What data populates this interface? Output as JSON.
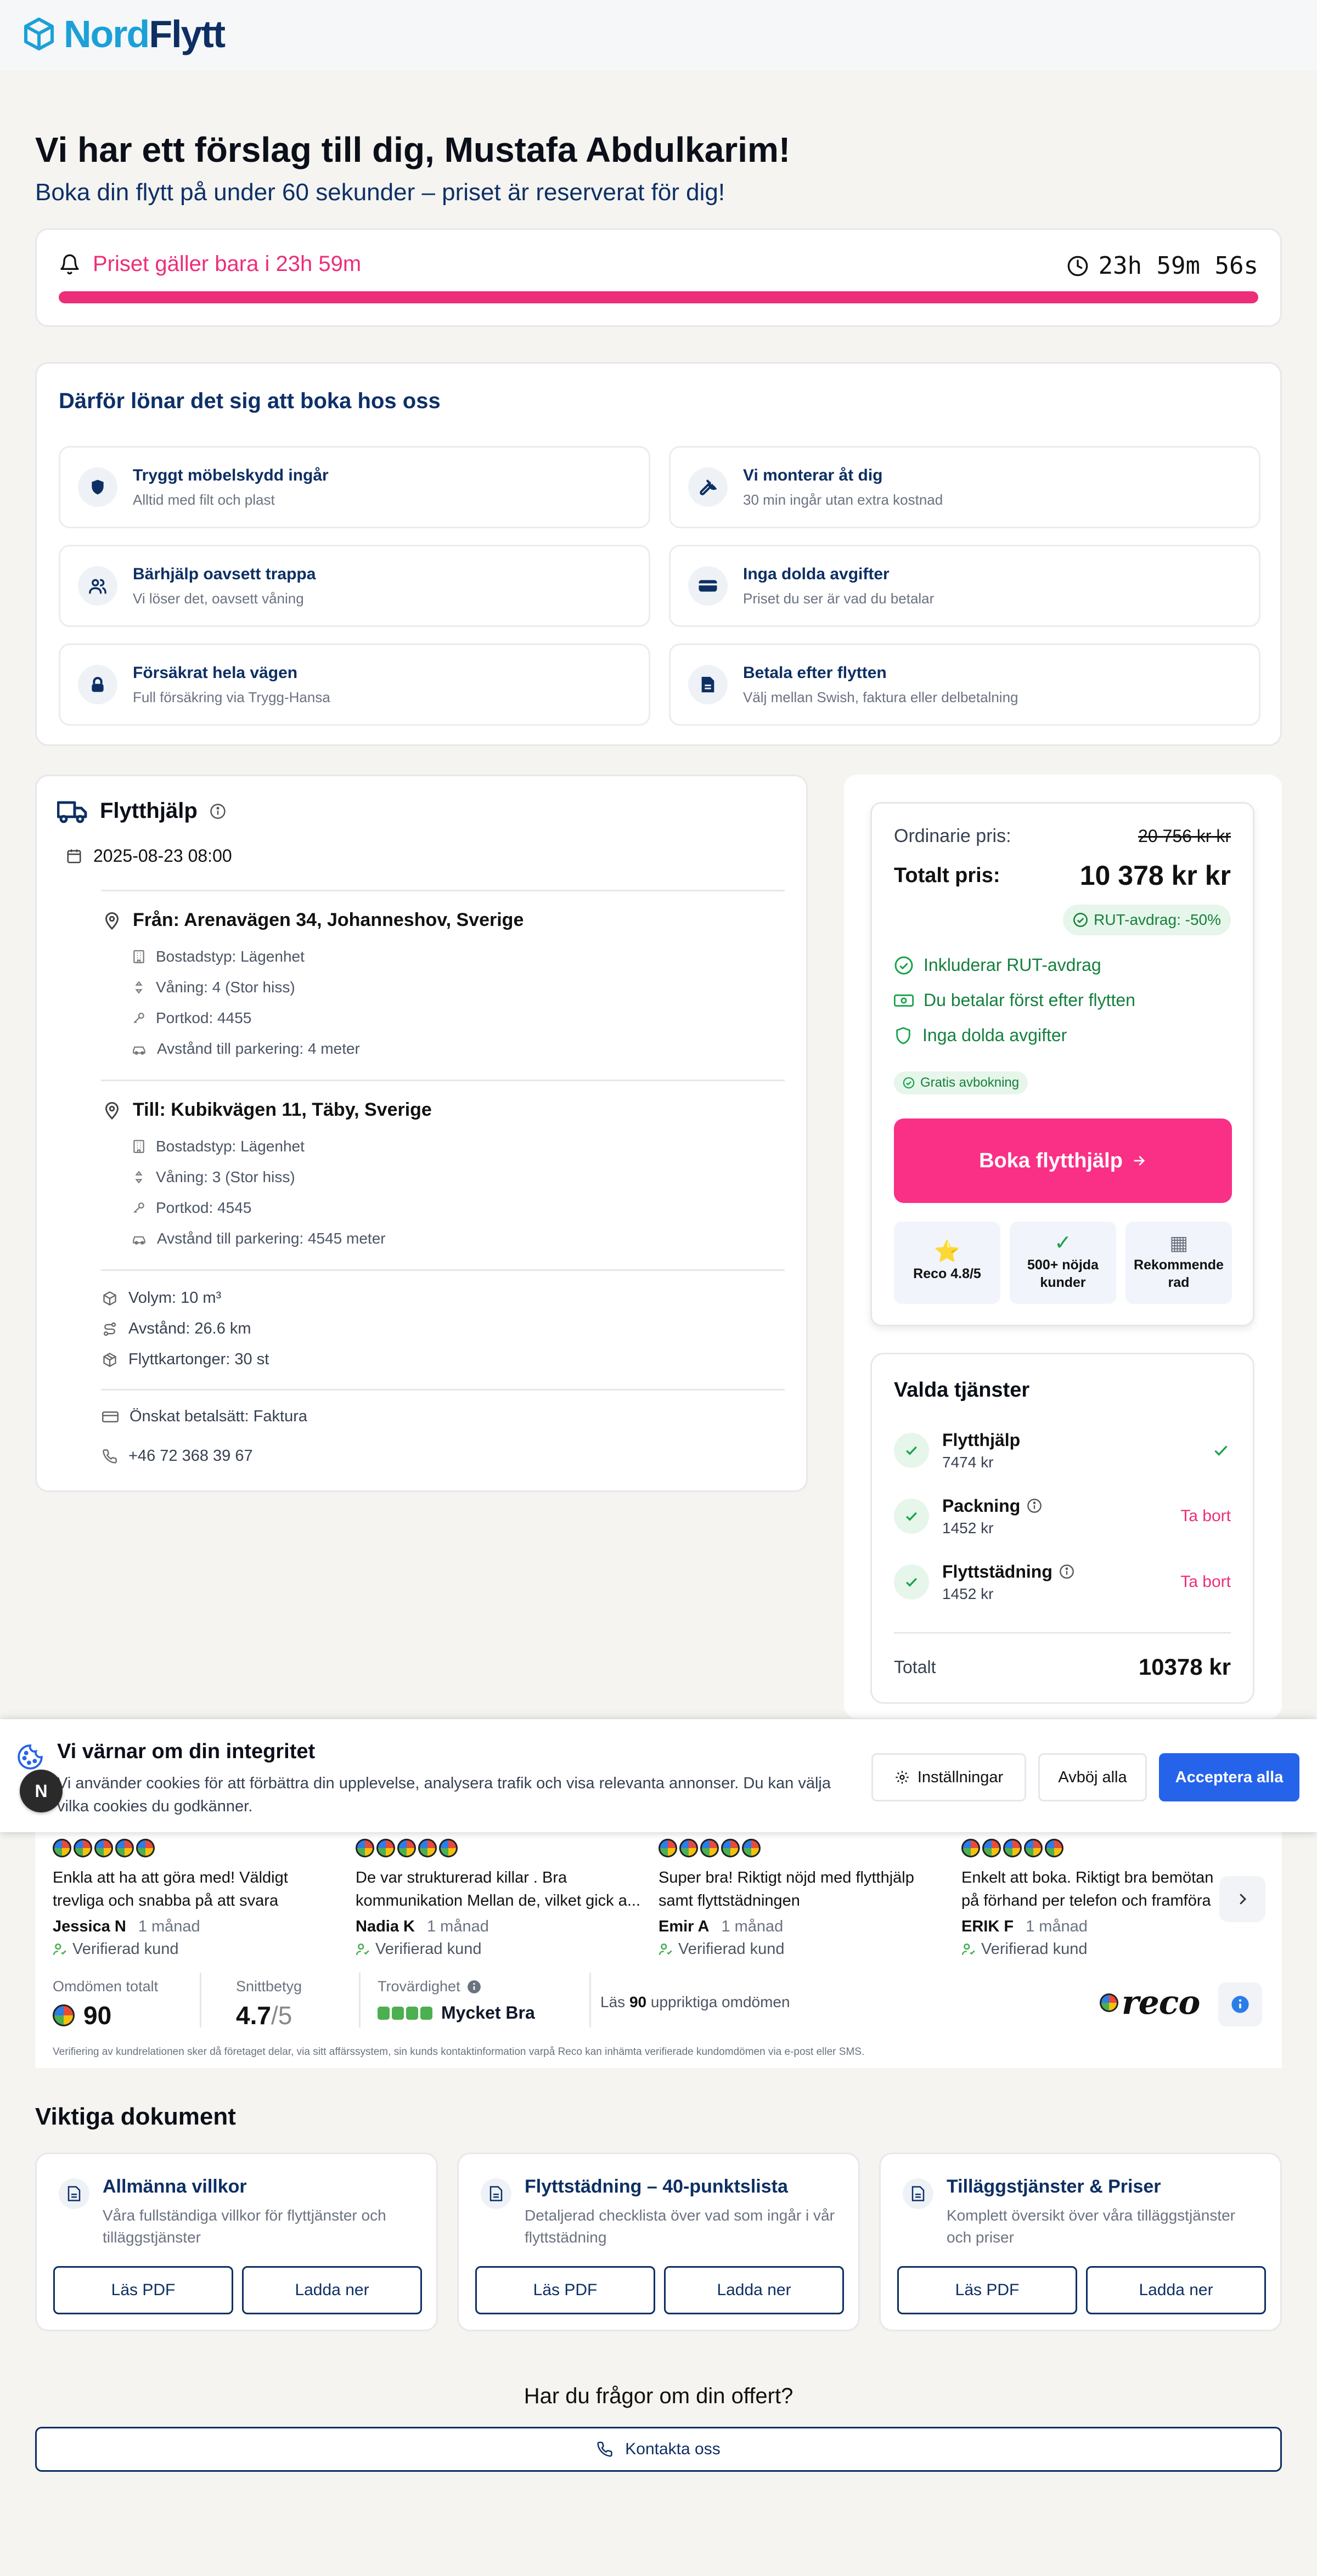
{
  "brand": {
    "nord": "Nord",
    "flytt": "Flytt"
  },
  "greeting": {
    "title": "Vi har ett förslag till dig, Mustafa Abdulkarim!",
    "subtitle": "Boka din flytt på under 60 sekunder – priset är reserverat för dig!"
  },
  "timer": {
    "label": "Priset gäller bara i 23h 59m",
    "countdown": "23h 59m 56s",
    "progress_percent": 100
  },
  "benefits": {
    "title": "Därför lönar det sig att boka hos oss",
    "items": [
      {
        "icon": "shield-icon",
        "title": "Tryggt möbelskydd ingår",
        "sub": "Alltid med filt och plast"
      },
      {
        "icon": "wrench-icon",
        "title": "Vi monterar åt dig",
        "sub": "30 min ingår utan extra kostnad"
      },
      {
        "icon": "people-icon",
        "title": "Bärhjälp oavsett trappa",
        "sub": "Vi löser det, oavsett våning"
      },
      {
        "icon": "card-icon",
        "title": "Inga dolda avgifter",
        "sub": "Priset du ser är vad du betalar"
      },
      {
        "icon": "lock-icon",
        "title": "Försäkrat hela vägen",
        "sub": "Full försäkring via Trygg-Hansa"
      },
      {
        "icon": "document-icon",
        "title": "Betala efter flytten",
        "sub": "Välj mellan Swish, faktura eller delbetalning"
      }
    ]
  },
  "details": {
    "service": "Flytthjälp",
    "date": "2025-08-23 08:00",
    "from": {
      "address": "Från: Arenavägen 34, Johanneshov, Sverige",
      "housing": "Bostadstyp: Lägenhet",
      "floor": "Våning: 4 (Stor hiss)",
      "code": "Portkod: 4455",
      "parking": "Avstånd till parkering: 4 meter"
    },
    "to": {
      "address": "Till: Kubikvägen 11, Täby, Sverige",
      "housing": "Bostadstyp: Lägenhet",
      "floor": "Våning: 3 (Stor hiss)",
      "code": "Portkod: 4545",
      "parking": "Avstånd till parkering: 4545 meter"
    },
    "volume": "Volym: 10 m³",
    "distance": "Avstånd: 26.6 km",
    "boxes": "Flyttkartonger: 30 st",
    "payment": "Önskat betalsätt: Faktura",
    "phone": "+46 72 368 39 67"
  },
  "price": {
    "ordinary_label": "Ordinarie pris:",
    "ordinary_value": "20 756 kr kr",
    "total_label": "Totalt pris:",
    "total_value": "10 378 kr kr",
    "rut": "RUT-avdrag: -50%",
    "check1": "Inkluderar RUT-avdrag",
    "check2": "Du betalar först efter flytten",
    "check3": "Inga dolda avgifter",
    "free_cancel": "Gratis avbokning",
    "book_button": "Boka flytthjälp",
    "badges": [
      {
        "icon": "⭐",
        "label": "Reco 4.8/5"
      },
      {
        "icon": "✓",
        "label": "500+ nöjda kunder"
      },
      {
        "icon": "▦",
        "label": "Rekommenderad"
      }
    ]
  },
  "services": {
    "title": "Valda tjänster",
    "items": [
      {
        "name": "Flytthjälp",
        "price": "7474 kr"
      },
      {
        "name": "Packning",
        "price": "1452 kr",
        "action": "Ta bort"
      },
      {
        "name": "Flyttstädning",
        "price": "1452 kr",
        "action": "Ta bort"
      }
    ],
    "total_label": "Totalt",
    "total_value": "10378 kr"
  },
  "cookie": {
    "title": "Vi värnar om din integritet",
    "text": "Vi använder cookies för att förbättra din upplevelse, analysera trafik och visa relevanta annonser. Du kan välja vilka cookies du godkänner.",
    "settings": "Inställningar",
    "reject": "Avböj alla",
    "accept": "Acceptera alla",
    "avatar": "N"
  },
  "reviews": {
    "items": [
      {
        "text": "Enkla att ha att göra med! Väldigt trevliga och snabba på att svara",
        "name": "Jessica N",
        "when": "1 månad"
      },
      {
        "text": "De var strukturerad killar . Bra kommunikation Mellan de, vilket gick a...",
        "name": "Nadia K",
        "when": "1 månad"
      },
      {
        "text": "Super bra! Riktigt nöjd med flytthjälp samt flyttstädningen",
        "name": "Emir A",
        "when": "1 månad"
      },
      {
        "text": "Enkelt att boka. Riktigt bra bemötande på förhand per telefon och framföra",
        "name": "ERIK F",
        "when": "1 månad"
      }
    ],
    "verified": "Verifierad kund",
    "total_label": "Omdömen totalt",
    "total_value": "90",
    "avg_label": "Snittbetyg",
    "avg_value": "4.7",
    "avg_max": "/5",
    "trust_label": "Trovärdighet",
    "trust_value": "Mycket Bra",
    "read_prefix": "Läs ",
    "read_count": "90",
    "read_suffix": " uppriktiga omdömen",
    "reco_logo": "reco",
    "disclaimer": "Verifiering av kundrelationen sker då företaget delar, via sitt affärssystem, sin kunds kontaktinformation varpå Reco kan inhämta verifierade kundomdömen via e-post eller SMS."
  },
  "documents": {
    "title": "Viktiga dokument",
    "read": "Läs PDF",
    "download": "Ladda ner",
    "items": [
      {
        "title": "Allmänna villkor",
        "sub": "Våra fullständiga villkor för flyttjänster och tilläggstjänster"
      },
      {
        "title": "Flyttstädning – 40-punktslista",
        "sub": "Detaljerad checklista över vad som ingår i vår flyttstädning"
      },
      {
        "title": "Tilläggstjänster & Priser",
        "sub": "Komplett översikt över våra tilläggstjänster och priser"
      }
    ]
  },
  "contact": {
    "question": "Har du frågor om din offert?",
    "button": "Kontakta oss"
  },
  "colors": {
    "brand_blue": "#0d2f63",
    "brand_cyan": "#1ba0d8",
    "accent_pink": "#ec2e79",
    "success_green": "#15803d",
    "primary_blue": "#2563eb"
  }
}
